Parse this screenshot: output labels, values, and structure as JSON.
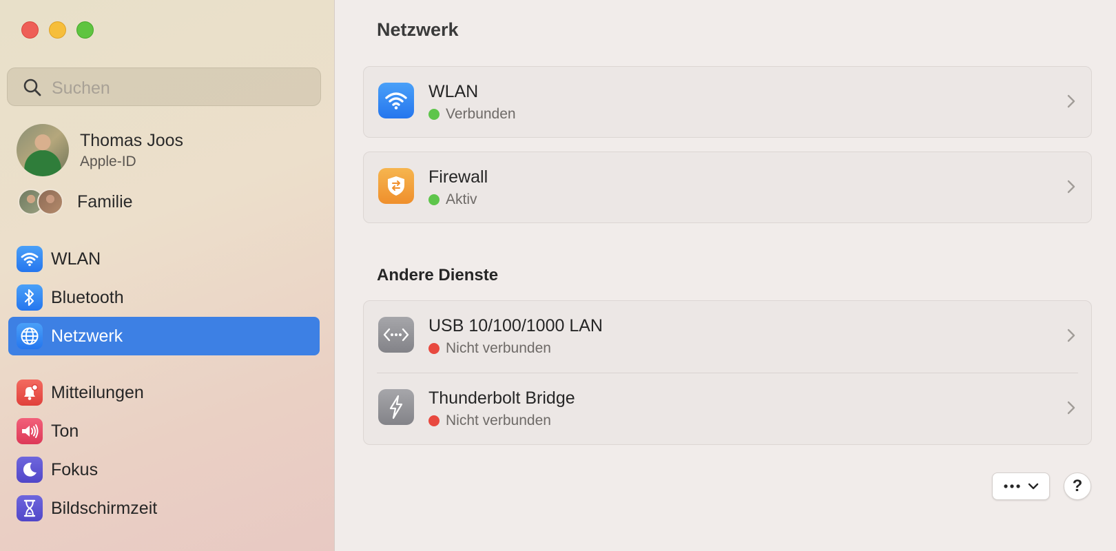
{
  "sidebar": {
    "search_placeholder": "Suchen",
    "profile": {
      "name": "Thomas Joos",
      "subtitle": "Apple-ID"
    },
    "family_label": "Familie",
    "items": [
      {
        "label": "WLAN",
        "icon": "wifi-icon",
        "color": "#2f84f0"
      },
      {
        "label": "Bluetooth",
        "icon": "bluetooth-icon",
        "color": "#2f84f0"
      },
      {
        "label": "Netzwerk",
        "icon": "globe-icon",
        "color": "#2f84f0",
        "active": true
      },
      {
        "label": "Mitteilungen",
        "icon": "bell-icon",
        "color": "#e84b43"
      },
      {
        "label": "Ton",
        "icon": "speaker-icon",
        "color": "#e64763"
      },
      {
        "label": "Fokus",
        "icon": "moon-icon",
        "color": "#5a50d0"
      },
      {
        "label": "Bildschirmzeit",
        "icon": "hourglass-icon",
        "color": "#5a50d0"
      }
    ]
  },
  "main": {
    "title": "Netzwerk",
    "services": [
      {
        "title": "WLAN",
        "status": "Verbunden",
        "status_color": "#5ec54b",
        "icon": "wifi-icon"
      },
      {
        "title": "Firewall",
        "status": "Aktiv",
        "status_color": "#5ec54b",
        "icon": "shield-icon"
      }
    ],
    "other_title": "Andere Dienste",
    "other_services": [
      {
        "title": "USB 10/100/1000 LAN",
        "status": "Nicht verbunden",
        "status_color": "#e8493f",
        "icon": "ethernet-icon"
      },
      {
        "title": "Thunderbolt Bridge",
        "status": "Nicht verbunden",
        "status_color": "#e8493f",
        "icon": "thunderbolt-icon"
      }
    ],
    "more_button_icon": "ellipsis-icon",
    "help_label": "?"
  }
}
